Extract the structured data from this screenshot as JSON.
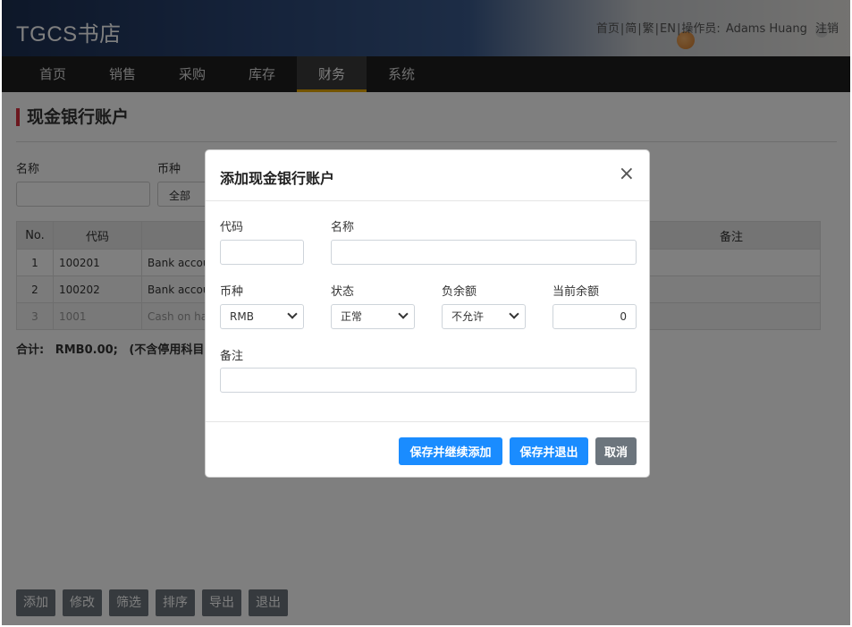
{
  "header": {
    "logo": "TGCS书店",
    "links": [
      "首页",
      "简",
      "繁",
      "EN"
    ],
    "operator_label": "操作员:",
    "operator_name": "Adams Huang",
    "logout": "注销"
  },
  "nav": [
    "首页",
    "销售",
    "采购",
    "库存",
    "财务",
    "系统"
  ],
  "nav_active": "财务",
  "page": {
    "title": "现金银行账户",
    "filter": {
      "name_label": "名称",
      "currency_label": "币种",
      "currency_value": "全部"
    },
    "table": {
      "headers": [
        "No.",
        "代码",
        "",
        "备注"
      ],
      "rows": [
        {
          "no": "1",
          "code": "100201",
          "name": "Bank accou"
        },
        {
          "no": "2",
          "code": "100202",
          "name": "Bank accou"
        },
        {
          "no": "3",
          "code": "1001",
          "name": "Cash on har"
        }
      ]
    },
    "summary": {
      "label": "合计:",
      "amount": "RMB0.00;",
      "note": "(不含停用科目)"
    },
    "buttons": [
      "添加",
      "修改",
      "筛选",
      "排序",
      "导出",
      "退出"
    ]
  },
  "modal": {
    "title": "添加现金银行账户",
    "close": "×",
    "code_label": "代码",
    "code_value": "",
    "name_label": "名称",
    "name_value": "",
    "currency_label": "币种",
    "currency_value": "RMB",
    "status_label": "状态",
    "status_value": "正常",
    "negative_label": "负余额",
    "negative_value": "不允许",
    "balance_label": "当前余额",
    "balance_value": "0",
    "remark_label": "备注",
    "remark_value": "",
    "save_continue": "保存并继续添加",
    "save_exit": "保存并退出",
    "cancel": "取消"
  },
  "colors": {
    "nav_bg": "#1f1f1f",
    "nav_active_underline": "#e6a800",
    "title_accent": "#d9303e",
    "primary": "#1a8cff",
    "secondary": "#6c757d"
  }
}
